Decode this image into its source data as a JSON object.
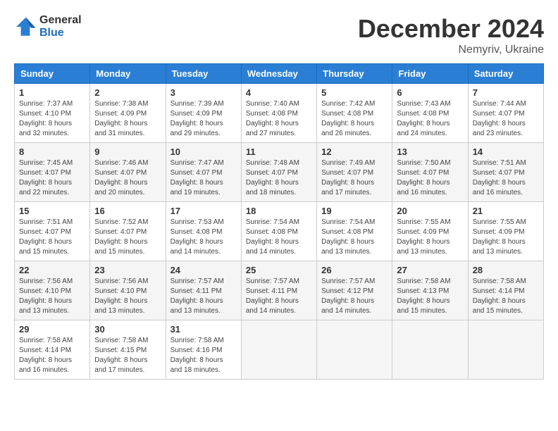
{
  "header": {
    "logo_general": "General",
    "logo_blue": "Blue",
    "title": "December 2024",
    "location": "Nemyriv, Ukraine"
  },
  "weekdays": [
    "Sunday",
    "Monday",
    "Tuesday",
    "Wednesday",
    "Thursday",
    "Friday",
    "Saturday"
  ],
  "weeks": [
    [
      {
        "day": "1",
        "sunrise": "7:37 AM",
        "sunset": "4:10 PM",
        "daylight": "8 hours and 32 minutes."
      },
      {
        "day": "2",
        "sunrise": "7:38 AM",
        "sunset": "4:09 PM",
        "daylight": "8 hours and 31 minutes."
      },
      {
        "day": "3",
        "sunrise": "7:39 AM",
        "sunset": "4:09 PM",
        "daylight": "8 hours and 29 minutes."
      },
      {
        "day": "4",
        "sunrise": "7:40 AM",
        "sunset": "4:08 PM",
        "daylight": "8 hours and 27 minutes."
      },
      {
        "day": "5",
        "sunrise": "7:42 AM",
        "sunset": "4:08 PM",
        "daylight": "8 hours and 26 minutes."
      },
      {
        "day": "6",
        "sunrise": "7:43 AM",
        "sunset": "4:08 PM",
        "daylight": "8 hours and 24 minutes."
      },
      {
        "day": "7",
        "sunrise": "7:44 AM",
        "sunset": "4:07 PM",
        "daylight": "8 hours and 23 minutes."
      }
    ],
    [
      {
        "day": "8",
        "sunrise": "7:45 AM",
        "sunset": "4:07 PM",
        "daylight": "8 hours and 22 minutes."
      },
      {
        "day": "9",
        "sunrise": "7:46 AM",
        "sunset": "4:07 PM",
        "daylight": "8 hours and 20 minutes."
      },
      {
        "day": "10",
        "sunrise": "7:47 AM",
        "sunset": "4:07 PM",
        "daylight": "8 hours and 19 minutes."
      },
      {
        "day": "11",
        "sunrise": "7:48 AM",
        "sunset": "4:07 PM",
        "daylight": "8 hours and 18 minutes."
      },
      {
        "day": "12",
        "sunrise": "7:49 AM",
        "sunset": "4:07 PM",
        "daylight": "8 hours and 17 minutes."
      },
      {
        "day": "13",
        "sunrise": "7:50 AM",
        "sunset": "4:07 PM",
        "daylight": "8 hours and 16 minutes."
      },
      {
        "day": "14",
        "sunrise": "7:51 AM",
        "sunset": "4:07 PM",
        "daylight": "8 hours and 16 minutes."
      }
    ],
    [
      {
        "day": "15",
        "sunrise": "7:51 AM",
        "sunset": "4:07 PM",
        "daylight": "8 hours and 15 minutes."
      },
      {
        "day": "16",
        "sunrise": "7:52 AM",
        "sunset": "4:07 PM",
        "daylight": "8 hours and 15 minutes."
      },
      {
        "day": "17",
        "sunrise": "7:53 AM",
        "sunset": "4:08 PM",
        "daylight": "8 hours and 14 minutes."
      },
      {
        "day": "18",
        "sunrise": "7:54 AM",
        "sunset": "4:08 PM",
        "daylight": "8 hours and 14 minutes."
      },
      {
        "day": "19",
        "sunrise": "7:54 AM",
        "sunset": "4:08 PM",
        "daylight": "8 hours and 13 minutes."
      },
      {
        "day": "20",
        "sunrise": "7:55 AM",
        "sunset": "4:09 PM",
        "daylight": "8 hours and 13 minutes."
      },
      {
        "day": "21",
        "sunrise": "7:55 AM",
        "sunset": "4:09 PM",
        "daylight": "8 hours and 13 minutes."
      }
    ],
    [
      {
        "day": "22",
        "sunrise": "7:56 AM",
        "sunset": "4:10 PM",
        "daylight": "8 hours and 13 minutes."
      },
      {
        "day": "23",
        "sunrise": "7:56 AM",
        "sunset": "4:10 PM",
        "daylight": "8 hours and 13 minutes."
      },
      {
        "day": "24",
        "sunrise": "7:57 AM",
        "sunset": "4:11 PM",
        "daylight": "8 hours and 13 minutes."
      },
      {
        "day": "25",
        "sunrise": "7:57 AM",
        "sunset": "4:11 PM",
        "daylight": "8 hours and 14 minutes."
      },
      {
        "day": "26",
        "sunrise": "7:57 AM",
        "sunset": "4:12 PM",
        "daylight": "8 hours and 14 minutes."
      },
      {
        "day": "27",
        "sunrise": "7:58 AM",
        "sunset": "4:13 PM",
        "daylight": "8 hours and 15 minutes."
      },
      {
        "day": "28",
        "sunrise": "7:58 AM",
        "sunset": "4:14 PM",
        "daylight": "8 hours and 15 minutes."
      }
    ],
    [
      {
        "day": "29",
        "sunrise": "7:58 AM",
        "sunset": "4:14 PM",
        "daylight": "8 hours and 16 minutes."
      },
      {
        "day": "30",
        "sunrise": "7:58 AM",
        "sunset": "4:15 PM",
        "daylight": "8 hours and 17 minutes."
      },
      {
        "day": "31",
        "sunrise": "7:58 AM",
        "sunset": "4:16 PM",
        "daylight": "8 hours and 18 minutes."
      },
      null,
      null,
      null,
      null
    ]
  ]
}
